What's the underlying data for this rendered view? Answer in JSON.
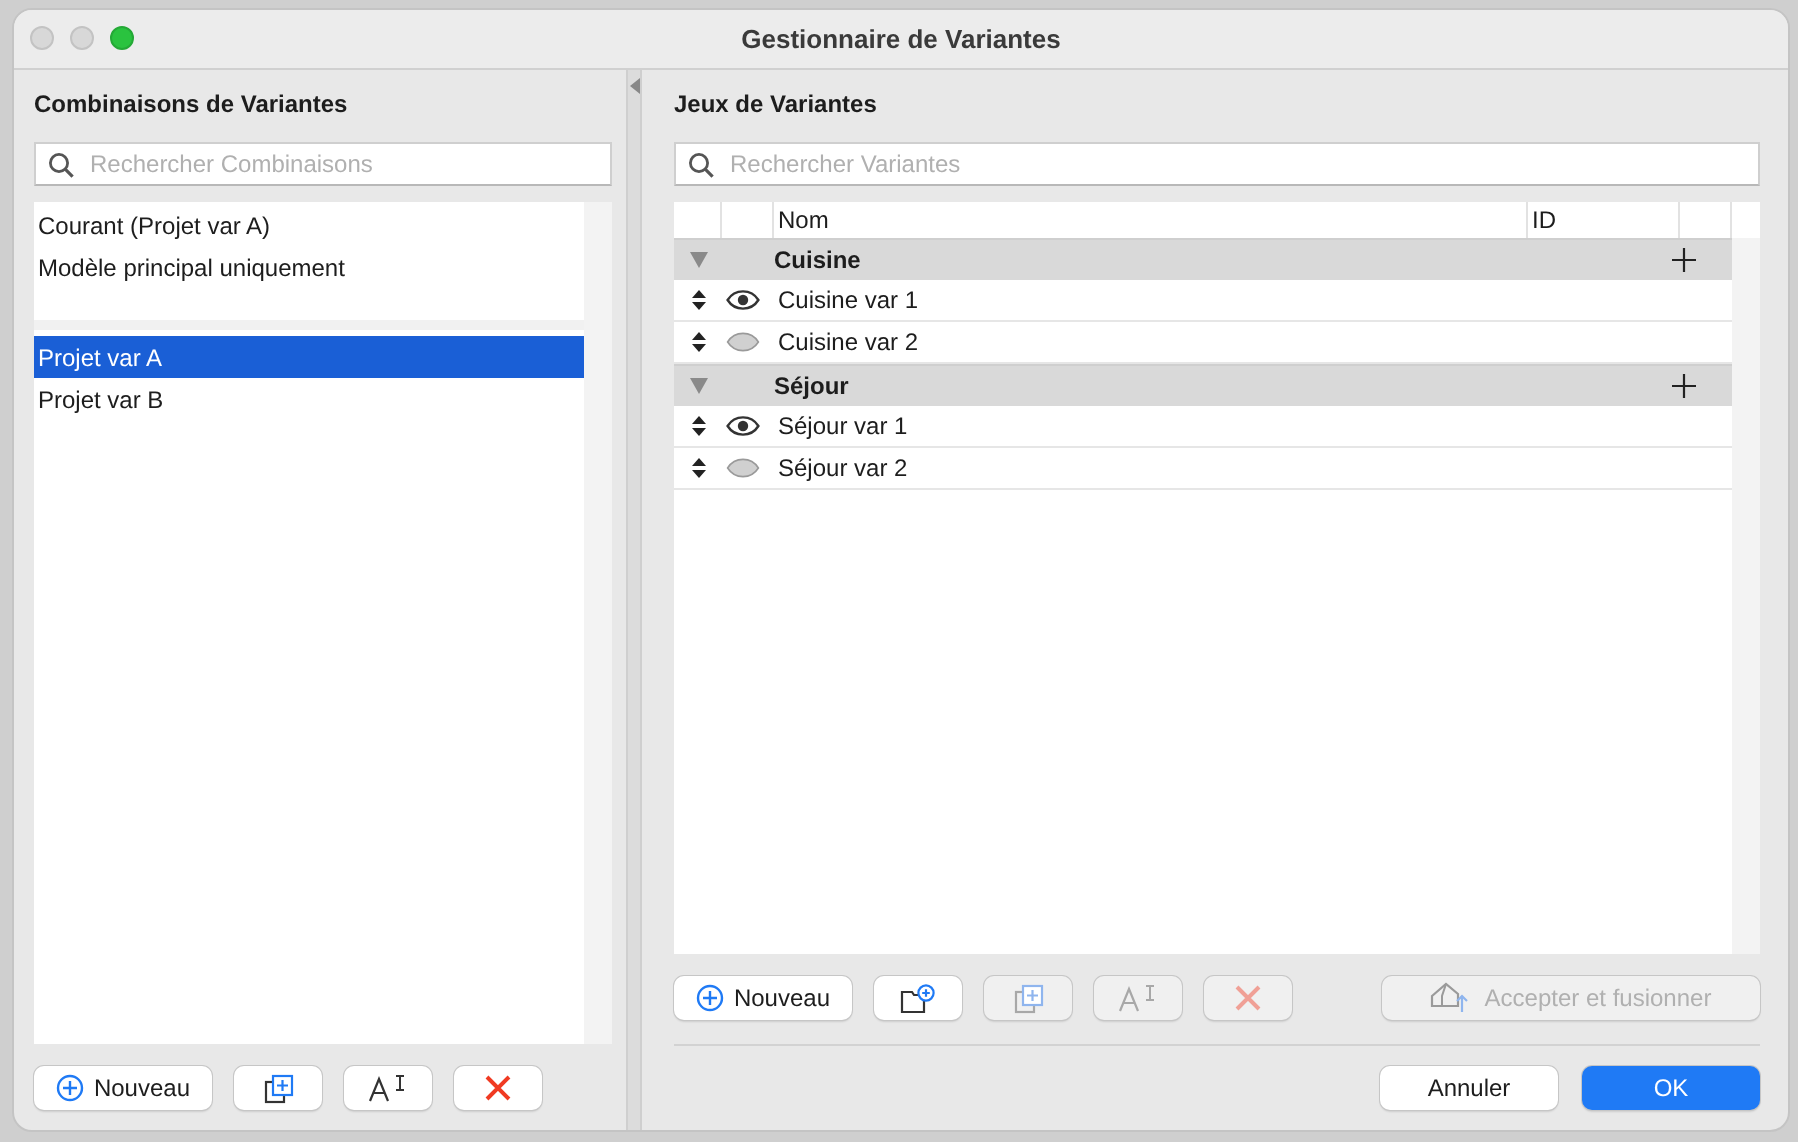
{
  "window": {
    "title": "Gestionnaire de Variantes"
  },
  "combinations": {
    "heading": "Combinaisons de Variantes",
    "search": {
      "placeholder": "Rechercher Combinaisons"
    },
    "fixed_items": [
      {
        "label": "Courant (Projet var A)",
        "selected": false
      },
      {
        "label": "Modèle principal uniquement",
        "selected": false
      }
    ],
    "items": [
      {
        "label": "Projet var A",
        "selected": true
      },
      {
        "label": "Projet var B",
        "selected": false
      }
    ],
    "buttons": [
      {
        "kind": "new",
        "label": "Nouveau",
        "disabled": false
      },
      {
        "kind": "duplicate",
        "disabled": false
      },
      {
        "kind": "rename",
        "disabled": false
      },
      {
        "kind": "delete",
        "disabled": false
      }
    ]
  },
  "variant_sets": {
    "heading": "Jeux de Variantes",
    "search": {
      "placeholder": "Rechercher Variantes"
    },
    "columns": [
      "Nom",
      "ID"
    ],
    "groups": [
      {
        "name": "Cuisine",
        "expanded": true,
        "variants": [
          {
            "name": "Cuisine var 1",
            "visible": true
          },
          {
            "name": "Cuisine var 2",
            "visible": false
          }
        ]
      },
      {
        "name": "Séjour",
        "expanded": true,
        "variants": [
          {
            "name": "Séjour var 1",
            "visible": true
          },
          {
            "name": "Séjour var 2",
            "visible": false
          }
        ]
      }
    ],
    "buttons": [
      {
        "kind": "new",
        "label": "Nouveau",
        "disabled": false
      },
      {
        "kind": "new-group",
        "disabled": false
      },
      {
        "kind": "duplicate",
        "disabled": true
      },
      {
        "kind": "rename",
        "disabled": true
      },
      {
        "kind": "delete",
        "disabled": true
      },
      {
        "kind": "merge",
        "label": "Accepter et fusionner",
        "disabled": true
      }
    ]
  },
  "footer": {
    "cancel": "Annuler",
    "ok": "OK"
  }
}
